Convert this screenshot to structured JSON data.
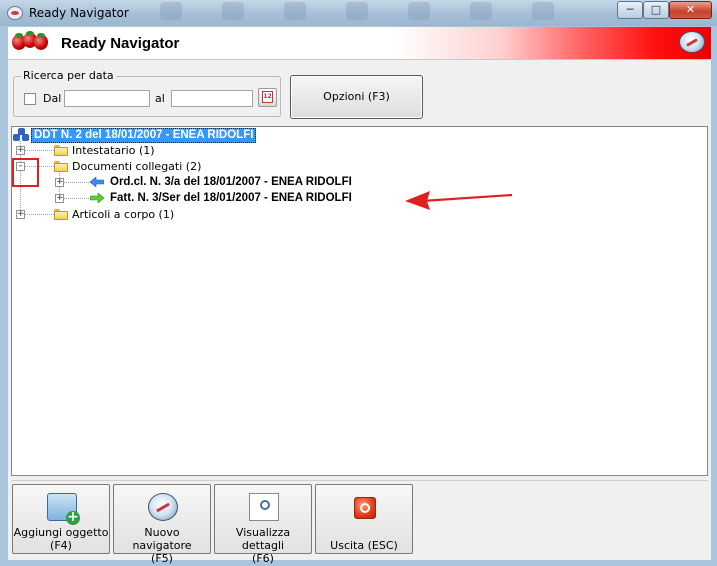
{
  "window": {
    "title": "Ready Navigator",
    "min_icon": "minimize-icon",
    "max_icon": "maximize-icon",
    "close_icon": "close-icon"
  },
  "header": {
    "app_title": "Ready Navigator",
    "accent_gradient_end": "#ee0000"
  },
  "date_filter": {
    "group_label": "Ricerca per data",
    "from_label": "Dal",
    "from_value": "",
    "to_label": "al",
    "to_value": "",
    "calendar_day": "12",
    "checked": false
  },
  "options_button": {
    "label": "Opzioni (F3)"
  },
  "tree": {
    "root": {
      "label": "DDT N. 2 del 18/01/2007 - ENEA RIDOLFI",
      "selected": true
    },
    "nodes": [
      {
        "label": "Intestatario (1)",
        "expanded": false
      },
      {
        "label": "Documenti collegati (2)",
        "expanded": true,
        "children": [
          {
            "label": "Ord.cl. N. 3/a del 18/01/2007 - ENEA RIDOLFI",
            "icon": "arrow-left-icon"
          },
          {
            "label": "Fatt. N. 3/Ser del 18/01/2007 - ENEA RIDOLFI",
            "icon": "arrow-right-icon"
          }
        ]
      },
      {
        "label": "Articoli a corpo (1)",
        "expanded": false
      }
    ]
  },
  "annotation": {
    "highlight_color": "#e02020"
  },
  "toolbar": [
    {
      "label_line1": "Aggiungi oggetto",
      "label_line2": "(F4)",
      "icon": "add-object-icon"
    },
    {
      "label_line1": "Nuovo navigatore",
      "label_line2": "(F5)",
      "icon": "compass-icon"
    },
    {
      "label_line1": "Visualizza dettagli",
      "label_line2": "(F6)",
      "icon": "view-details-icon"
    },
    {
      "label_line1": "",
      "label_line2": "Uscita (ESC)",
      "icon": "exit-icon"
    }
  ]
}
